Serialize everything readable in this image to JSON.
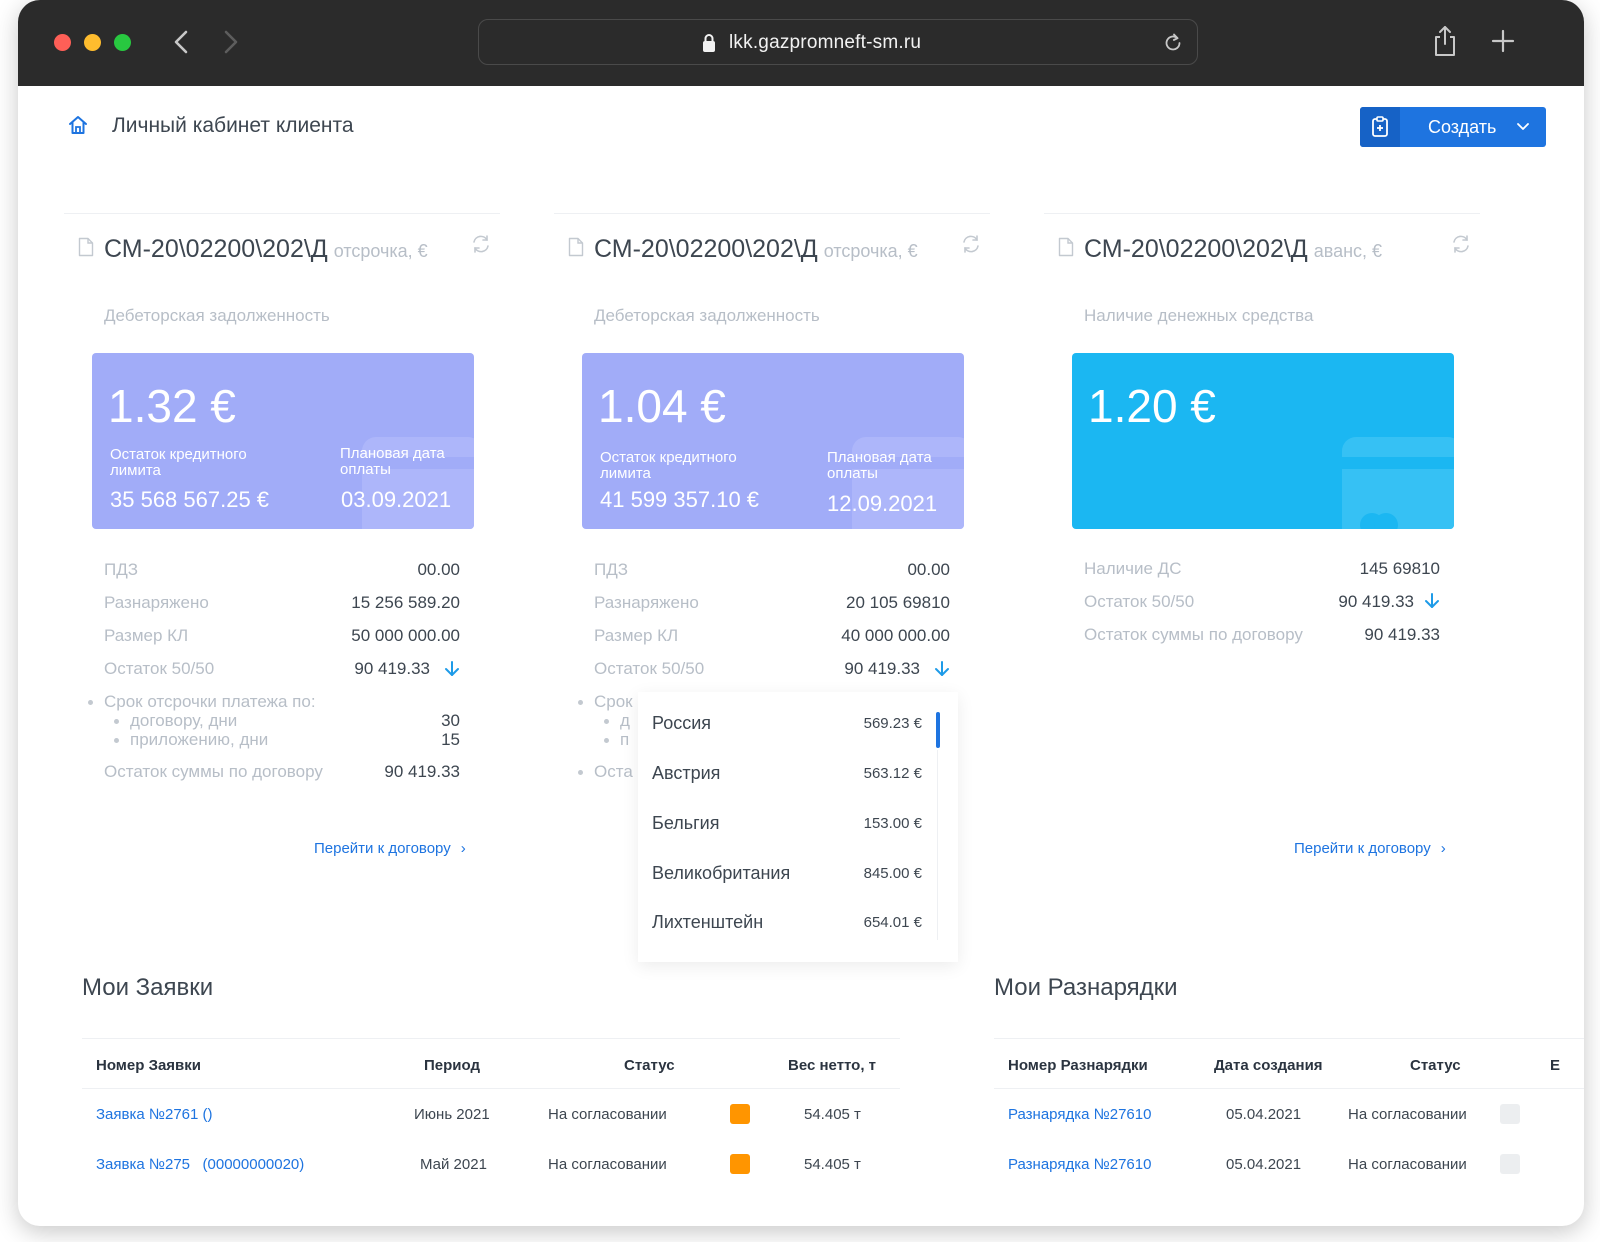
{
  "browser": {
    "url": "lkk.gazpromneft-sm.ru"
  },
  "header": {
    "title": "Личный кабинет клиента",
    "create_label": "Создать"
  },
  "cards": [
    {
      "contract": "СМ-20\\02200\\202\\Д",
      "type": "отсрочка, €",
      "section": "Дебеторская задолженность",
      "tile_value": "1.32 €",
      "tile_left_label": "Остаток кредитного лимита",
      "tile_left_value": "35 568 567.25 €",
      "tile_right_label": "Плановая дата оплаты",
      "tile_right_value": "03.09.2021",
      "rows": [
        {
          "k": "ПДЗ",
          "v": "00.00"
        },
        {
          "k": "Разнаряжено",
          "v": "15 256 589.20"
        },
        {
          "k": "Размер КЛ",
          "v": "50 000 000.00"
        },
        {
          "k": "Остаток 50/50",
          "v": "90 419.33"
        }
      ],
      "deferral_label": "Срок отсрочки платежа по:",
      "deferral_items": [
        {
          "k": "договору, дни",
          "v": "30"
        },
        {
          "k": "приложению, дни",
          "v": "15"
        }
      ],
      "balance_label": "Остаток суммы по договору",
      "balance_value": "90 419.33",
      "link": "Перейти к договору"
    },
    {
      "contract": "СМ-20\\02200\\202\\Д",
      "type": "отсрочка, €",
      "section": "Дебеторская задолженность",
      "tile_value": "1.04 €",
      "tile_left_label": "Остаток кредитного лимита",
      "tile_left_value": "41 599 357.10 €",
      "tile_right_label": "Плановая дата оплаты",
      "tile_right_value": "12.09.2021",
      "rows": [
        {
          "k": "ПДЗ",
          "v": "00.00"
        },
        {
          "k": "Разнаряжено",
          "v": "20 105 69810"
        },
        {
          "k": "Размер КЛ",
          "v": "40 000 000.00"
        },
        {
          "k": "Остаток 50/50",
          "v": "90 419.33"
        }
      ],
      "hidden_fragments": [
        "Срок",
        "д",
        "п",
        "Оста"
      ]
    },
    {
      "contract": "СМ-20\\02200\\202\\Д",
      "type": "аванс, €",
      "section": "Наличие денежных средства",
      "tile_value": "1.20 €",
      "rows": [
        {
          "k": "Наличие ДС",
          "v": "145 69810"
        },
        {
          "k": "Остаток 50/50",
          "v": "90 419.33"
        },
        {
          "k": "Остаток суммы по договору",
          "v": "90 419.33"
        }
      ],
      "link": "Перейти к договору"
    }
  ],
  "dropdown": {
    "items": [
      {
        "country": "Россия",
        "amount": "569.23 €"
      },
      {
        "country": "Австрия",
        "amount": "563.12 €"
      },
      {
        "country": "Бельгия",
        "amount": "153.00 €"
      },
      {
        "country": "Великобритания",
        "amount": "845.00 €"
      },
      {
        "country": "Лихтенштейн",
        "amount": "654.01 €"
      }
    ]
  },
  "requests": {
    "title": "Мои Заявки",
    "columns": [
      "Номер Заявки",
      "Период",
      "Статус",
      "Вес нетто, т"
    ],
    "rows": [
      {
        "number": "Заявка №2761 ()",
        "period": "Июнь 2021",
        "status": "На согласовании",
        "weight": "54.405 т"
      },
      {
        "number": "Заявка №275   (00000000020)",
        "period": "Май 2021",
        "status": "На согласовании",
        "weight": "54.405 т"
      }
    ]
  },
  "allocations": {
    "title": "Мои Разнарядки",
    "columns": [
      "Номер Разнарядки",
      "Дата создания",
      "Статус",
      "Е"
    ],
    "rows": [
      {
        "number": "Разнарядка №27610",
        "date": "05.04.2021",
        "status": "На согласовании"
      },
      {
        "number": "Разнарядка №27610",
        "date": "05.04.2021",
        "status": "На согласовании"
      }
    ]
  },
  "colors": {
    "accent": "#1e74e0",
    "tile_purple": "#a1acf8",
    "tile_cyan": "#1bb7f2",
    "status_orange": "#ff9500",
    "status_grey": "#eceef0"
  }
}
